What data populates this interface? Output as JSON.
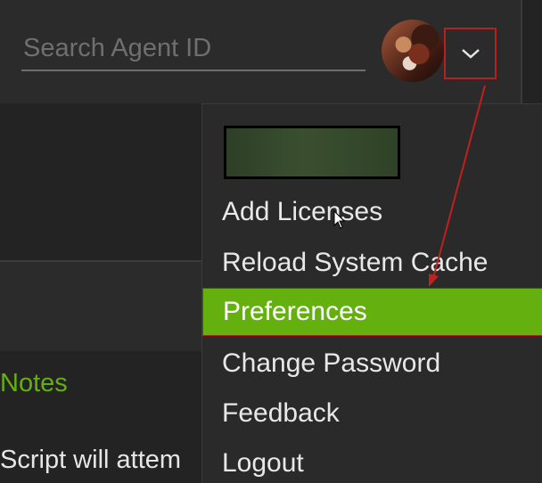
{
  "search": {
    "placeholder": "Search Agent ID"
  },
  "icons": {
    "dropdown_toggle": "chevron-down-icon",
    "avatar": "user-avatar"
  },
  "background": {
    "notes_heading": "Notes",
    "notes_text": "Script will attem"
  },
  "menu": {
    "items": [
      {
        "label": "Add Licenses"
      },
      {
        "label": "Reload System Cache"
      },
      {
        "label": "Preferences"
      },
      {
        "label": "Change Password"
      },
      {
        "label": "Feedback"
      },
      {
        "label": "Logout"
      }
    ],
    "active_item": "Preferences"
  },
  "colors": {
    "accent_green": "#63b00e",
    "annotation_red": "#b8201f",
    "background": "#232323",
    "header": "#2b2b2b"
  }
}
